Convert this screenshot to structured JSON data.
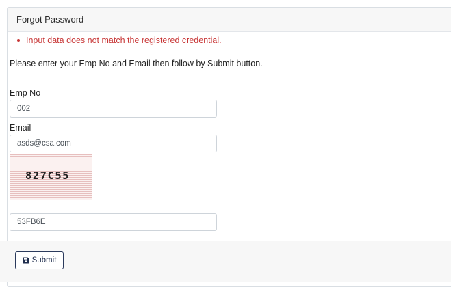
{
  "header": {
    "title": "Forgot Password"
  },
  "error": {
    "message": "Input data does not match the registered credential."
  },
  "instructions": "Please enter your Emp No and Email then follow by Submit button.",
  "form": {
    "emp_no": {
      "label": "Emp No",
      "value": "002"
    },
    "email": {
      "label": "Email",
      "value": "asds@csa.com"
    },
    "captcha": {
      "image_text": "827C55",
      "value": "53FB6E"
    }
  },
  "footer": {
    "submit_label": "Submit",
    "submit_icon": "floppy-disk-icon"
  },
  "colors": {
    "error": "#c83737",
    "border": "#ced4da",
    "header_bg": "#f7f7f7",
    "button_border": "#2b3a5c"
  }
}
